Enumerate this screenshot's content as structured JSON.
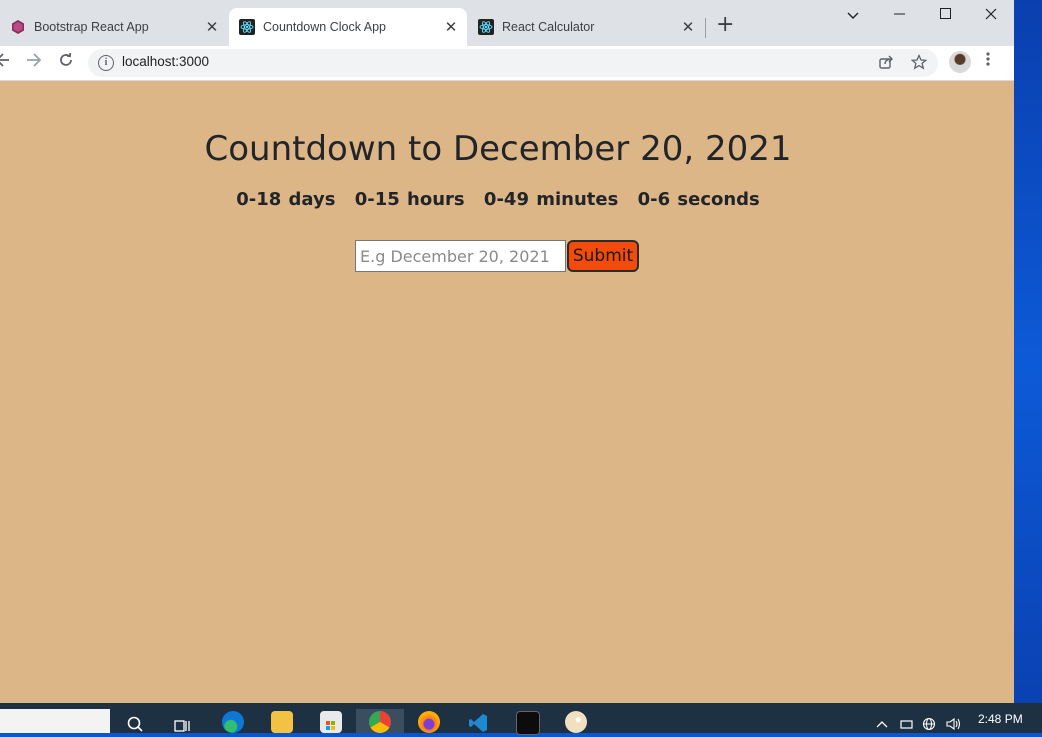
{
  "browser": {
    "tabs": [
      {
        "title": "Bootstrap React App",
        "icon": "bootstrap-icon",
        "active": false
      },
      {
        "title": "Countdown Clock App",
        "icon": "react-icon",
        "active": true
      },
      {
        "title": "React Calculator",
        "icon": "react-icon",
        "active": false
      }
    ],
    "new_tab_label": "+",
    "url": "localhost:3000",
    "window_controls": {
      "chevron": "⌵",
      "minimize": "—",
      "maximize": "☐",
      "close": "✕"
    }
  },
  "app": {
    "heading": "Countdown to December 20, 2021",
    "countdown": {
      "days": "0-18 days",
      "hours": "0-15 hours",
      "minutes": "0-49 minutes",
      "seconds": "0-6 seconds"
    },
    "date_input_placeholder": "E.g December 20, 2021",
    "submit_label": "Submit"
  },
  "taskbar": {
    "clock": "2:48 PM"
  },
  "colors": {
    "page_background": "#ddb688",
    "submit_button": "#f24b0c",
    "taskbar": "#1e3142"
  }
}
